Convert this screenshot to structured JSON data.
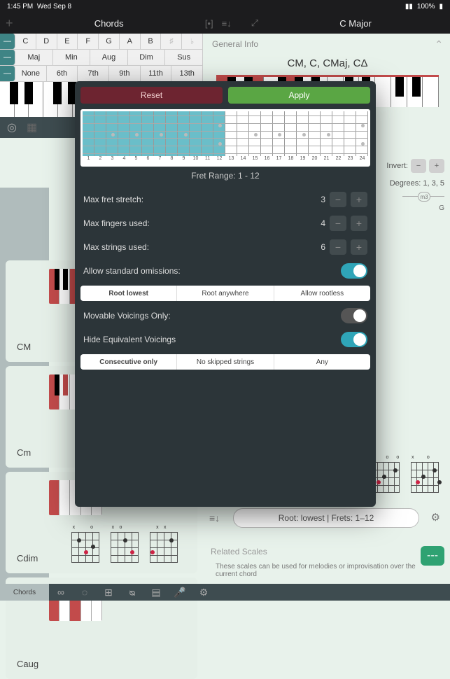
{
  "statusbar": {
    "time": "1:45 PM",
    "date": "Wed Sep 8",
    "battery": "100%"
  },
  "top": {
    "left_title": "Chords",
    "right_title": "C Major"
  },
  "noterow": [
    "C",
    "D",
    "E",
    "F",
    "G",
    "A",
    "B"
  ],
  "qualrow": [
    "Maj",
    "Min",
    "Aug",
    "Dim",
    "Sus"
  ],
  "extrow": [
    "None",
    "6th",
    "7th",
    "9th",
    "11th",
    "13th"
  ],
  "cards": [
    {
      "label": "CM"
    },
    {
      "label": "Cm"
    },
    {
      "label": "Cdim"
    },
    {
      "label": "Caug"
    }
  ],
  "right": {
    "general": "General Info",
    "names": "CM, C, CMaj, CΔ",
    "invert": "Invert:",
    "degrees": "Degrees: 1, 3, 5",
    "m3": "m3",
    "g": "G"
  },
  "modal": {
    "reset": "Reset",
    "apply": "Apply",
    "fretnums": [
      "1",
      "2",
      "3",
      "4",
      "5",
      "6",
      "7",
      "8",
      "9",
      "10",
      "11",
      "12",
      "13",
      "14",
      "15",
      "16",
      "17",
      "18",
      "19",
      "20",
      "21",
      "22",
      "23",
      "24"
    ],
    "range": "Fret Range: 1 - 12",
    "maxstretch_l": "Max fret stretch:",
    "maxstretch_v": "3",
    "maxfingers_l": "Max fingers used:",
    "maxfingers_v": "4",
    "maxstrings_l": "Max strings used:",
    "maxstrings_v": "6",
    "omissions": "Allow standard omissions:",
    "seg1": [
      "Root lowest",
      "Root anywhere",
      "Allow rootless"
    ],
    "movable": "Movable Voicings Only:",
    "hideeq": "Hide Equivalent Voicings",
    "seg2": [
      "Consecutive only",
      "No skipped strings",
      "Any"
    ]
  },
  "rootbar": "Root: lowest  |  Frets: 1–12",
  "related": "Related Scales",
  "reltxt": "These scales can be used for melodies or improvisation over the current chord",
  "bottab": "Chords",
  "greenfab": "---"
}
